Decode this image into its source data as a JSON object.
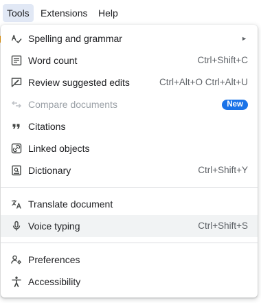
{
  "menubar": {
    "items": [
      {
        "label": "Tools",
        "active": true
      },
      {
        "label": "Extensions",
        "active": false
      },
      {
        "label": "Help",
        "active": false
      }
    ]
  },
  "menu": {
    "items": [
      {
        "label": "Spelling and grammar",
        "icon": "spellcheck-icon",
        "submenu": true
      },
      {
        "label": "Word count",
        "icon": "word-count-icon",
        "shortcut": "Ctrl+Shift+C"
      },
      {
        "label": "Review suggested edits",
        "icon": "review-edits-icon",
        "shortcut": "Ctrl+Alt+O Ctrl+Alt+U"
      },
      {
        "label": "Compare documents",
        "icon": "compare-icon",
        "badge": "New",
        "disabled": true
      },
      {
        "label": "Citations",
        "icon": "quote-icon"
      },
      {
        "label": "Linked objects",
        "icon": "link-icon"
      },
      {
        "label": "Dictionary",
        "icon": "dictionary-icon",
        "shortcut": "Ctrl+Shift+Y"
      },
      {
        "label": "Translate document",
        "icon": "translate-icon"
      },
      {
        "label": "Voice typing",
        "icon": "microphone-icon",
        "shortcut": "Ctrl+Shift+S",
        "highlighted": true
      },
      {
        "label": "Preferences",
        "icon": "preferences-icon"
      },
      {
        "label": "Accessibility",
        "icon": "accessibility-icon"
      }
    ],
    "submenu_arrow": "►"
  },
  "colors": {
    "active_menubar": "#e1e8f5",
    "badge": "#1a73e8",
    "hover_row": "#f1f3f4",
    "separator": "#dadce0",
    "disabled_text": "#9aa0a6"
  }
}
